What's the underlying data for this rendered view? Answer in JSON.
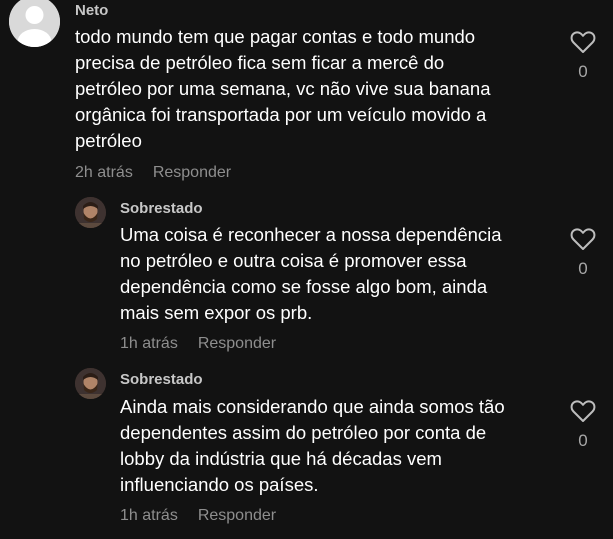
{
  "comments": [
    {
      "username": "Neto",
      "text": "todo mundo tem que pagar contas e todo mundo\nprecisa de petróleo fica sem ficar a mercê do\npetróleo por uma semana, vc não vive sua banana\norgânica foi transportada por um veículo movido a\npetróleo",
      "time": "2h atrás",
      "reply_label": "Responder",
      "likes": "0"
    },
    {
      "username": "Sobrestado",
      "text": "Uma coisa é reconhecer a nossa dependência\nno petróleo e outra coisa é promover essa\ndependência como se fosse algo bom, ainda\nmais sem expor os prb.",
      "time": "1h atrás",
      "reply_label": "Responder",
      "likes": "0"
    },
    {
      "username": "Sobrestado",
      "text": "Ainda mais considerando que ainda somos tão\ndependentes assim do petróleo por conta de\nlobby da indústria que há décadas vem\ninfluenciando os países.",
      "time": "1h atrás",
      "reply_label": "Responder",
      "likes": "0"
    }
  ],
  "icons": {
    "like": "heart-outline-icon"
  },
  "colors": {
    "background": "#121212",
    "text": "#ffffff",
    "muted": "#8e8e8e"
  }
}
